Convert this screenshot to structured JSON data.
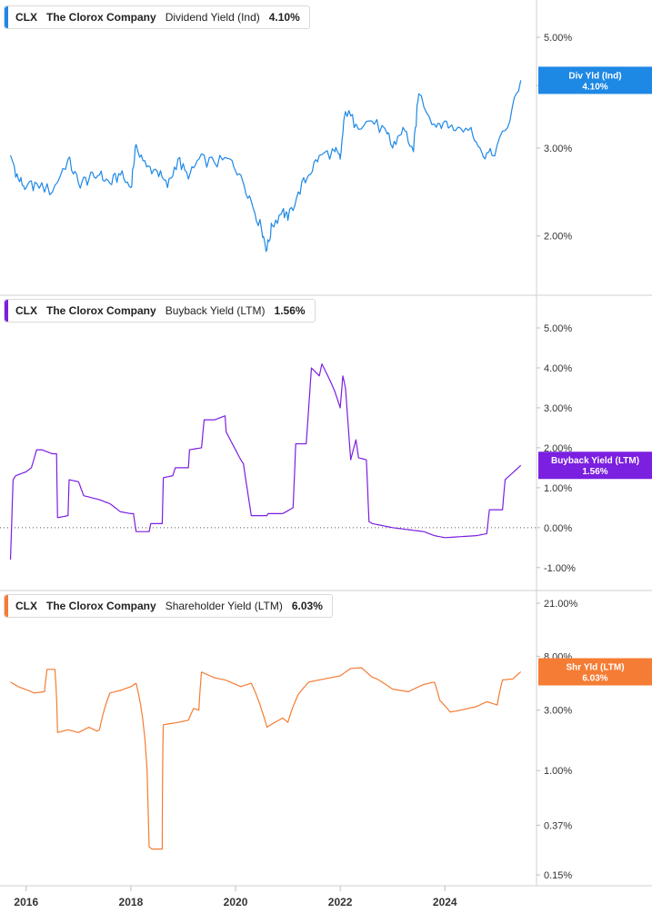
{
  "chart_data": [
    {
      "type": "line",
      "ticker": "CLX",
      "company": "The Clorox Company",
      "metric": "Dividend Yield (Ind)",
      "current_value": "4.10%",
      "tag_label": "Div Yld (Ind)",
      "tag_value": "4.10%",
      "color": "#1e88e5",
      "scale": "log",
      "ylim": [
        1.6,
        5.6
      ],
      "yticks": [
        "5.00%",
        "4.00%",
        "3.00%",
        "2.00%"
      ],
      "ytick_values": [
        5,
        4,
        3,
        2
      ],
      "series": [
        {
          "x": [
            2015.7,
            2015.85,
            2016.0,
            2016.2,
            2016.5,
            2016.8,
            2017.0,
            2017.2,
            2017.4,
            2017.6,
            2017.8,
            2018.0,
            2018.1,
            2018.3,
            2018.5,
            2018.7,
            2018.9,
            2019.1,
            2019.3,
            2019.6,
            2019.9,
            2020.1,
            2020.3,
            2020.5,
            2020.6,
            2020.7,
            2020.9,
            2021.0,
            2021.2,
            2021.4,
            2021.6,
            2021.9,
            2022.0,
            2022.1,
            2022.3,
            2022.6,
            2022.9,
            2023.0,
            2023.2,
            2023.4,
            2023.5,
            2023.8,
            2024.0,
            2024.2,
            2024.5,
            2024.7,
            2024.9,
            2025.2,
            2025.45
          ],
          "values": [
            2.9,
            2.6,
            2.5,
            2.55,
            2.45,
            2.85,
            2.55,
            2.6,
            2.65,
            2.55,
            2.65,
            2.5,
            3.05,
            2.75,
            2.7,
            2.5,
            2.85,
            2.6,
            2.85,
            2.8,
            2.85,
            2.65,
            2.35,
            2.05,
            1.88,
            2.1,
            2.25,
            2.15,
            2.45,
            2.65,
            2.9,
            2.95,
            2.85,
            3.55,
            3.35,
            3.4,
            3.2,
            3.0,
            3.3,
            2.95,
            3.85,
            3.35,
            3.4,
            3.25,
            3.3,
            2.95,
            2.9,
            3.3,
            4.1
          ]
        }
      ]
    },
    {
      "type": "line",
      "ticker": "CLX",
      "company": "The Clorox Company",
      "metric": "Buyback Yield (LTM)",
      "current_value": "1.56%",
      "tag_label": "Buyback Yield (LTM)",
      "tag_value": "1.56%",
      "color": "#7b1fe0",
      "scale": "linear",
      "ylim": [
        -1.3,
        5.5
      ],
      "yticks": [
        "5.00%",
        "4.00%",
        "3.00%",
        "2.00%",
        "1.00%",
        "0.00%",
        "-1.00%"
      ],
      "ytick_values": [
        5,
        4,
        3,
        2,
        1,
        0,
        -1
      ],
      "zero_line": true,
      "series": [
        {
          "x": [
            2015.7,
            2015.75,
            2015.8,
            2016.0,
            2016.1,
            2016.2,
            2016.3,
            2016.5,
            2016.58,
            2016.6,
            2016.8,
            2016.82,
            2017.0,
            2017.1,
            2017.4,
            2017.6,
            2017.8,
            2018.0,
            2018.05,
            2018.1,
            2018.35,
            2018.38,
            2018.6,
            2018.62,
            2018.8,
            2018.85,
            2019.1,
            2019.12,
            2019.35,
            2019.4,
            2019.6,
            2019.8,
            2019.82,
            2020.1,
            2020.15,
            2020.3,
            2020.6,
            2020.62,
            2020.9,
            2021.1,
            2021.15,
            2021.35,
            2021.45,
            2021.6,
            2021.65,
            2021.8,
            2021.9,
            2022.0,
            2022.05,
            2022.1,
            2022.2,
            2022.3,
            2022.35,
            2022.5,
            2022.55,
            2022.62,
            2023.0,
            2023.3,
            2023.6,
            2023.8,
            2024.0,
            2024.6,
            2024.8,
            2024.85,
            2025.1,
            2025.15,
            2025.45
          ],
          "values": [
            -0.8,
            1.2,
            1.3,
            1.4,
            1.5,
            1.95,
            1.95,
            1.85,
            1.85,
            0.25,
            0.3,
            1.2,
            1.15,
            0.8,
            0.7,
            0.6,
            0.4,
            0.35,
            0.35,
            -0.1,
            -0.1,
            0.1,
            0.1,
            1.25,
            1.3,
            1.5,
            1.5,
            1.95,
            2.0,
            2.7,
            2.7,
            2.8,
            2.4,
            1.7,
            1.6,
            0.3,
            0.3,
            0.35,
            0.35,
            0.5,
            2.1,
            2.1,
            4.0,
            3.8,
            4.1,
            3.7,
            3.4,
            3.0,
            3.8,
            3.5,
            1.7,
            2.2,
            1.75,
            1.7,
            0.15,
            0.1,
            0.0,
            -0.05,
            -0.1,
            -0.2,
            -0.25,
            -0.2,
            -0.15,
            0.45,
            0.45,
            1.2,
            1.56
          ]
        }
      ]
    },
    {
      "type": "line",
      "ticker": "CLX",
      "company": "The Clorox Company",
      "metric": "Shareholder Yield (LTM)",
      "current_value": "6.03%",
      "tag_label": "Shr Yld (LTM)",
      "tag_value": "6.03%",
      "color": "#f57c34",
      "scale": "log",
      "ylim": [
        0.15,
        21.0
      ],
      "yticks": [
        "21.00%",
        "8.00%",
        "3.00%",
        "1.00%",
        "0.37%",
        "0.15%"
      ],
      "ytick_values": [
        21,
        8,
        3,
        1,
        0.37,
        0.15
      ],
      "series": [
        {
          "x": [
            2015.7,
            2015.85,
            2016.1,
            2016.15,
            2016.35,
            2016.4,
            2016.55,
            2016.6,
            2016.8,
            2017.0,
            2017.2,
            2017.35,
            2017.4,
            2017.6,
            2017.8,
            2018.0,
            2018.1,
            2018.35,
            2018.4,
            2018.6,
            2018.62,
            2018.9,
            2019.1,
            2019.2,
            2019.3,
            2019.35,
            2019.6,
            2019.8,
            2020.1,
            2020.3,
            2020.5,
            2020.6,
            2020.9,
            2021.0,
            2021.2,
            2021.4,
            2021.6,
            2021.8,
            2022.0,
            2022.2,
            2022.4,
            2022.6,
            2022.7,
            2022.8,
            2023.0,
            2023.3,
            2023.6,
            2023.8,
            2023.9,
            2024.1,
            2024.3,
            2024.6,
            2024.8,
            2025.0,
            2025.1,
            2025.3,
            2025.45
          ],
          "values": [
            5.0,
            4.6,
            4.2,
            4.1,
            4.2,
            6.3,
            6.3,
            2.0,
            2.1,
            2.0,
            2.2,
            2.05,
            2.1,
            4.1,
            4.3,
            4.6,
            4.9,
            0.25,
            0.24,
            0.24,
            2.3,
            2.4,
            2.5,
            3.1,
            3.0,
            6.0,
            5.4,
            5.2,
            4.6,
            4.9,
            3.0,
            2.2,
            2.6,
            2.4,
            4.0,
            5.0,
            5.2,
            5.4,
            5.6,
            6.4,
            6.5,
            5.5,
            5.3,
            5.0,
            4.4,
            4.2,
            4.8,
            5.0,
            3.6,
            2.9,
            3.0,
            3.2,
            3.5,
            3.3,
            5.2,
            5.3,
            6.03
          ]
        }
      ]
    }
  ],
  "x_axis": {
    "labels": [
      "2016",
      "2018",
      "2020",
      "2022",
      "2024"
    ],
    "values": [
      2016,
      2018,
      2020,
      2022,
      2024
    ],
    "range": [
      2015.5,
      2025.75
    ]
  }
}
